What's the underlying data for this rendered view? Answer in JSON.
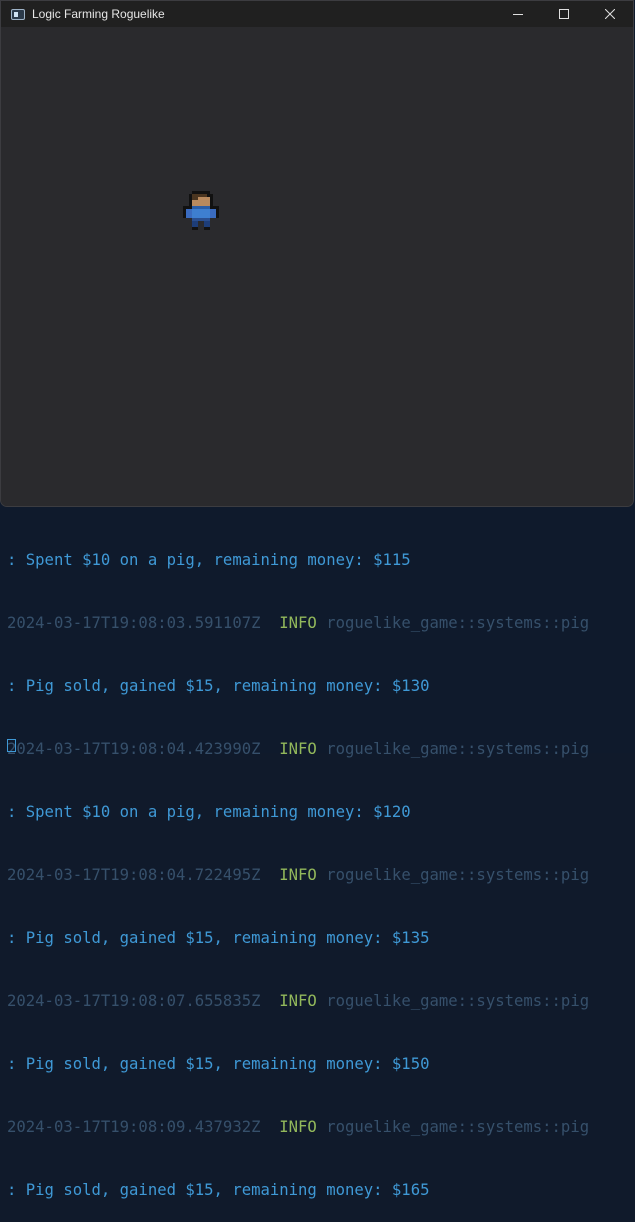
{
  "window": {
    "title": "Logic Farming Roguelike"
  },
  "player": {
    "icon": "farmer-player-sprite"
  },
  "log": [
    {
      "kind": "message",
      "text": ": Spent $10 on a pig, remaining money: $115"
    },
    {
      "kind": "header",
      "timestamp": "2024-03-17T19:08:03.591107Z",
      "level": "INFO",
      "target": "roguelike_game::systems::pig"
    },
    {
      "kind": "message",
      "text": ": Pig sold, gained $15, remaining money: $130"
    },
    {
      "kind": "header",
      "timestamp": "2024-03-17T19:08:04.423990Z",
      "level": "INFO",
      "target": "roguelike_game::systems::pig"
    },
    {
      "kind": "message",
      "text": ": Spent $10 on a pig, remaining money: $120"
    },
    {
      "kind": "header",
      "timestamp": "2024-03-17T19:08:04.722495Z",
      "level": "INFO",
      "target": "roguelike_game::systems::pig"
    },
    {
      "kind": "message",
      "text": ": Pig sold, gained $15, remaining money: $135"
    },
    {
      "kind": "header",
      "timestamp": "2024-03-17T19:08:07.655835Z",
      "level": "INFO",
      "target": "roguelike_game::systems::pig"
    },
    {
      "kind": "message",
      "text": ": Pig sold, gained $15, remaining money: $150"
    },
    {
      "kind": "header",
      "timestamp": "2024-03-17T19:08:09.437932Z",
      "level": "INFO",
      "target": "roguelike_game::systems::pig"
    },
    {
      "kind": "message",
      "text": ": Pig sold, gained $15, remaining money: $165"
    }
  ],
  "colors": {
    "terminal_bg": "#0f1a2c",
    "message": "#3f99d6",
    "timestamp": "#36506b",
    "level_info": "#92b85b",
    "game_bg": "#2a2a2d"
  }
}
